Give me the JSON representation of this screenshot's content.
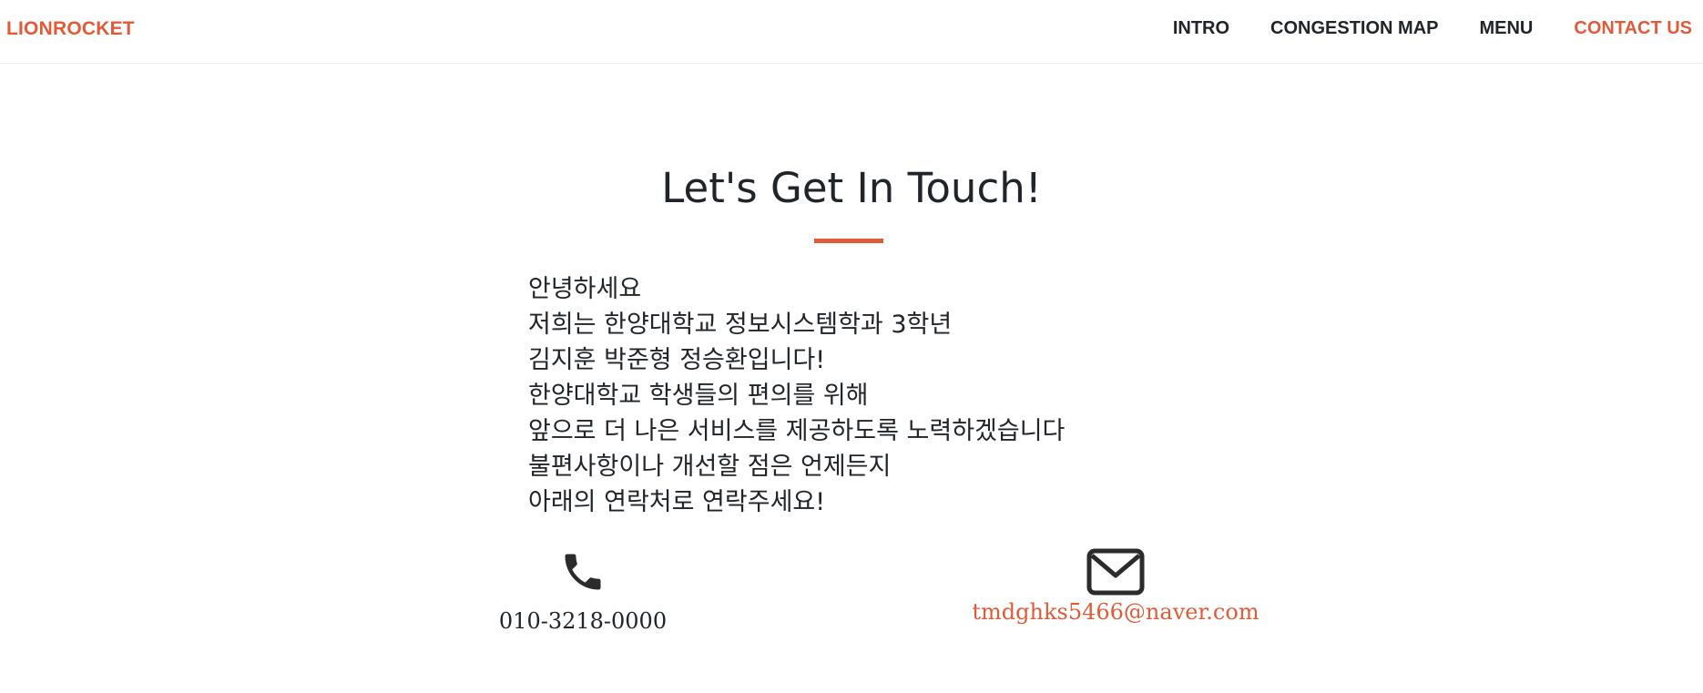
{
  "navbar": {
    "brand": "LIONROCKET",
    "links": [
      {
        "label": "INTRO"
      },
      {
        "label": "CONGESTION MAP"
      },
      {
        "label": "MENU"
      },
      {
        "label": "CONTACT US"
      }
    ],
    "active_link": "CONTACT US"
  },
  "contact": {
    "heading": "Let's Get In Touch!",
    "message_lines": [
      "안녕하세요",
      "저희는 한양대학교 정보시스템학과 3학년",
      "김지훈 박준형 정승환입니다!",
      "한양대학교 학생들의 편의를 위해",
      "앞으로 더 나은 서비스를 제공하도록 노력하겠습니다",
      "불편사항이나 개선할 점은 언제든지",
      "아래의 연락처로 연락주세요!"
    ],
    "phone": {
      "icon": "phone-icon",
      "number": "010-3218-0000"
    },
    "email": {
      "icon": "envelope-icon",
      "address": "tmdghks5466@naver.com"
    }
  },
  "colors": {
    "accent": "#e05c39",
    "text": "#212529"
  }
}
